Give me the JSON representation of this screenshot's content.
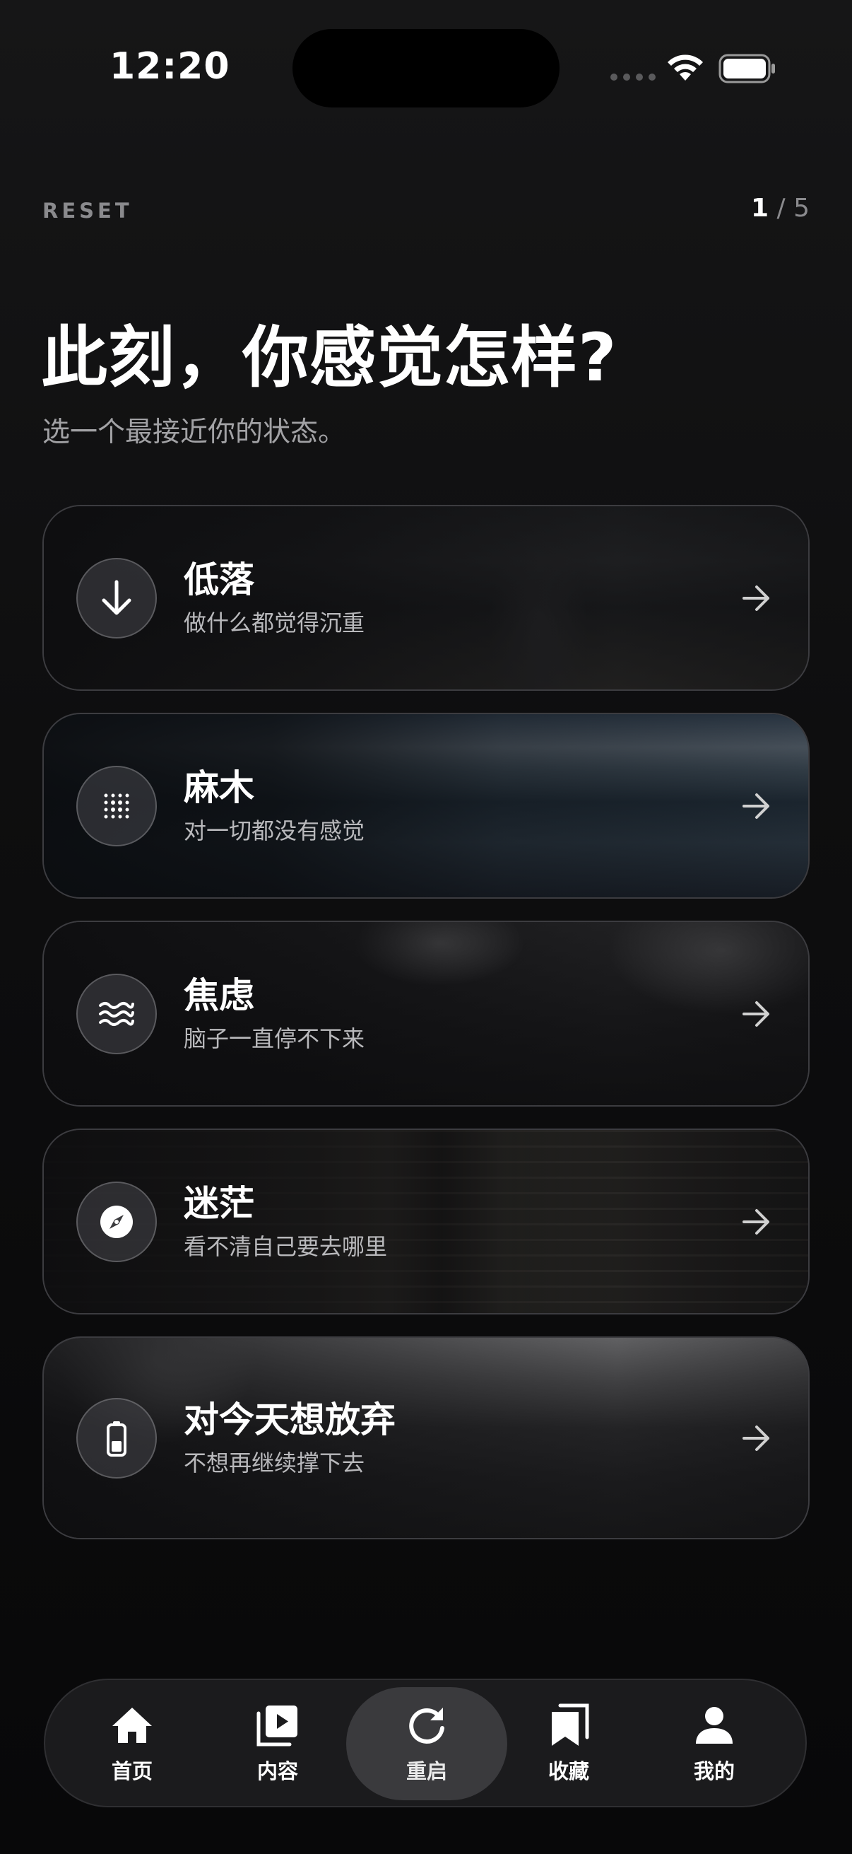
{
  "status_bar": {
    "time": "12:20"
  },
  "header": {
    "brand": "RESET",
    "page_current": "1",
    "page_separator": "/",
    "page_total": "5"
  },
  "question": {
    "title": "此刻，你感觉怎样?",
    "subtitle": "选一个最接近你的状态。"
  },
  "moods": [
    {
      "title": "低落",
      "subtitle": "做什么都觉得沉重",
      "icon": "arrow-down-icon"
    },
    {
      "title": "麻木",
      "subtitle": "对一切都没有感觉",
      "icon": "dot-grid-icon"
    },
    {
      "title": "焦虑",
      "subtitle": "脑子一直停不下来",
      "icon": "waves-icon"
    },
    {
      "title": "迷茫",
      "subtitle": "看不清自己要去哪里",
      "icon": "compass-icon"
    },
    {
      "title": "对今天想放弃",
      "subtitle": "不想再继续撑下去",
      "icon": "battery-low-icon"
    }
  ],
  "tabbar": {
    "tabs": [
      {
        "label": "首页",
        "icon": "home-icon"
      },
      {
        "label": "内容",
        "icon": "play-library-icon"
      },
      {
        "label": "重启",
        "icon": "refresh-icon",
        "active": true
      },
      {
        "label": "收藏",
        "icon": "bookmarks-icon"
      },
      {
        "label": "我的",
        "icon": "person-icon"
      }
    ]
  }
}
